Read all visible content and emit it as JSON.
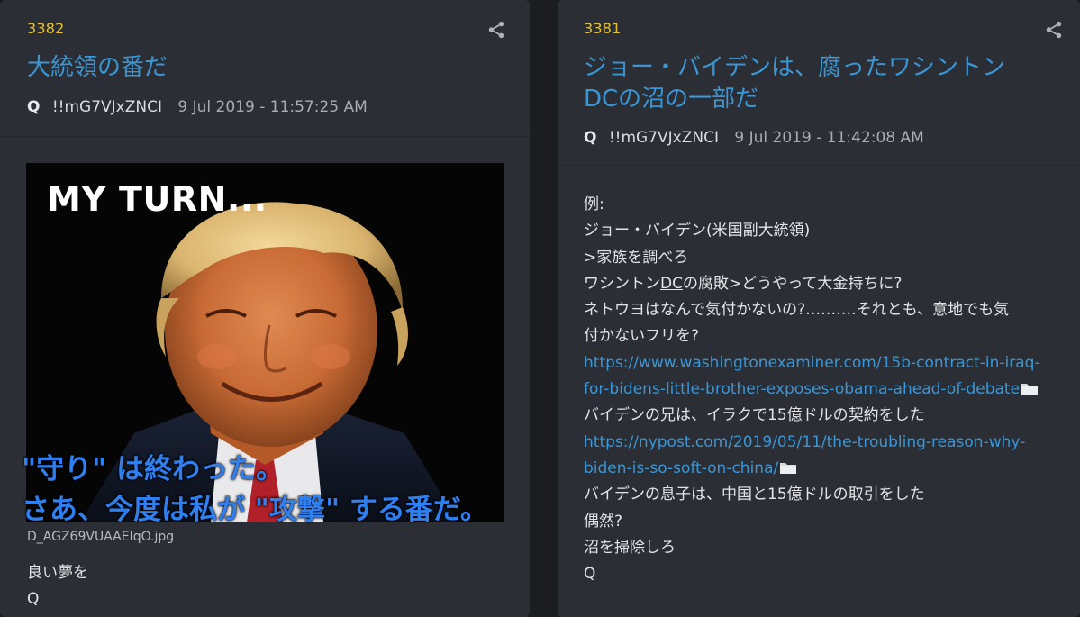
{
  "posts": [
    {
      "number": "3382",
      "title": "大統領の番だ",
      "author": "Q",
      "tripcode": "!!mG7VJxZNCI",
      "date": "9 Jul 2019 - 11:57:25 AM",
      "image": {
        "top_text": "MY TURN...",
        "overlay_line1": "\"守り\" は終わった。",
        "overlay_line2": "さあ、今度は私が \"攻撃\" する番だ。",
        "filename": "D_AGZ69VUAAEIqO.jpg"
      },
      "message": [
        "良い夢を",
        "Q"
      ]
    },
    {
      "number": "3381",
      "title_line1": "ジョー・バイデンは、腐ったワシントン",
      "title_line2": "DCの沼の一部だ",
      "author": "Q",
      "tripcode": "!!mG7VJxZNCI",
      "date": "9 Jul 2019 - 11:42:08 AM",
      "message": {
        "l1": "例:",
        "l2": "ジョー・バイデン(米国副大統領)",
        "l3": ">家族を調べろ",
        "l4_pre": "ワシントン",
        "l4_ul": "DC",
        "l4_post": "の腐敗>どうやって大金持ちに?",
        "l5": "ネトウヨはなんで気付かないの?……….それとも、意地でも気",
        "l6": "付かないフリを?",
        "link1_line1": "https://www.washingtonexaminer.com/15b-contract-in-iraq-",
        "link1_line2": "for-bidens-little-brother-exposes-obama-ahead-of-debate",
        "l9": "バイデンの兄は、イラクで15億ドルの契約をした",
        "link2_line1": "https://nypost.com/2019/05/11/the-troubling-reason-why-",
        "link2_line2": "biden-is-so-soft-on-china/",
        "l12": "バイデンの息子は、中国と15億ドルの取引をした",
        "l13": "偶然?",
        "l14": "沼を掃除しろ",
        "l15": "Q"
      }
    }
  ],
  "icons": {
    "share": "share-icon",
    "folder": "folder-icon"
  },
  "colors": {
    "post_number": "#e3c238",
    "title_link": "#3a96d4",
    "overlay_text": "#2f7ff0",
    "background": "#1c1d21",
    "card": "#2c2e35"
  }
}
